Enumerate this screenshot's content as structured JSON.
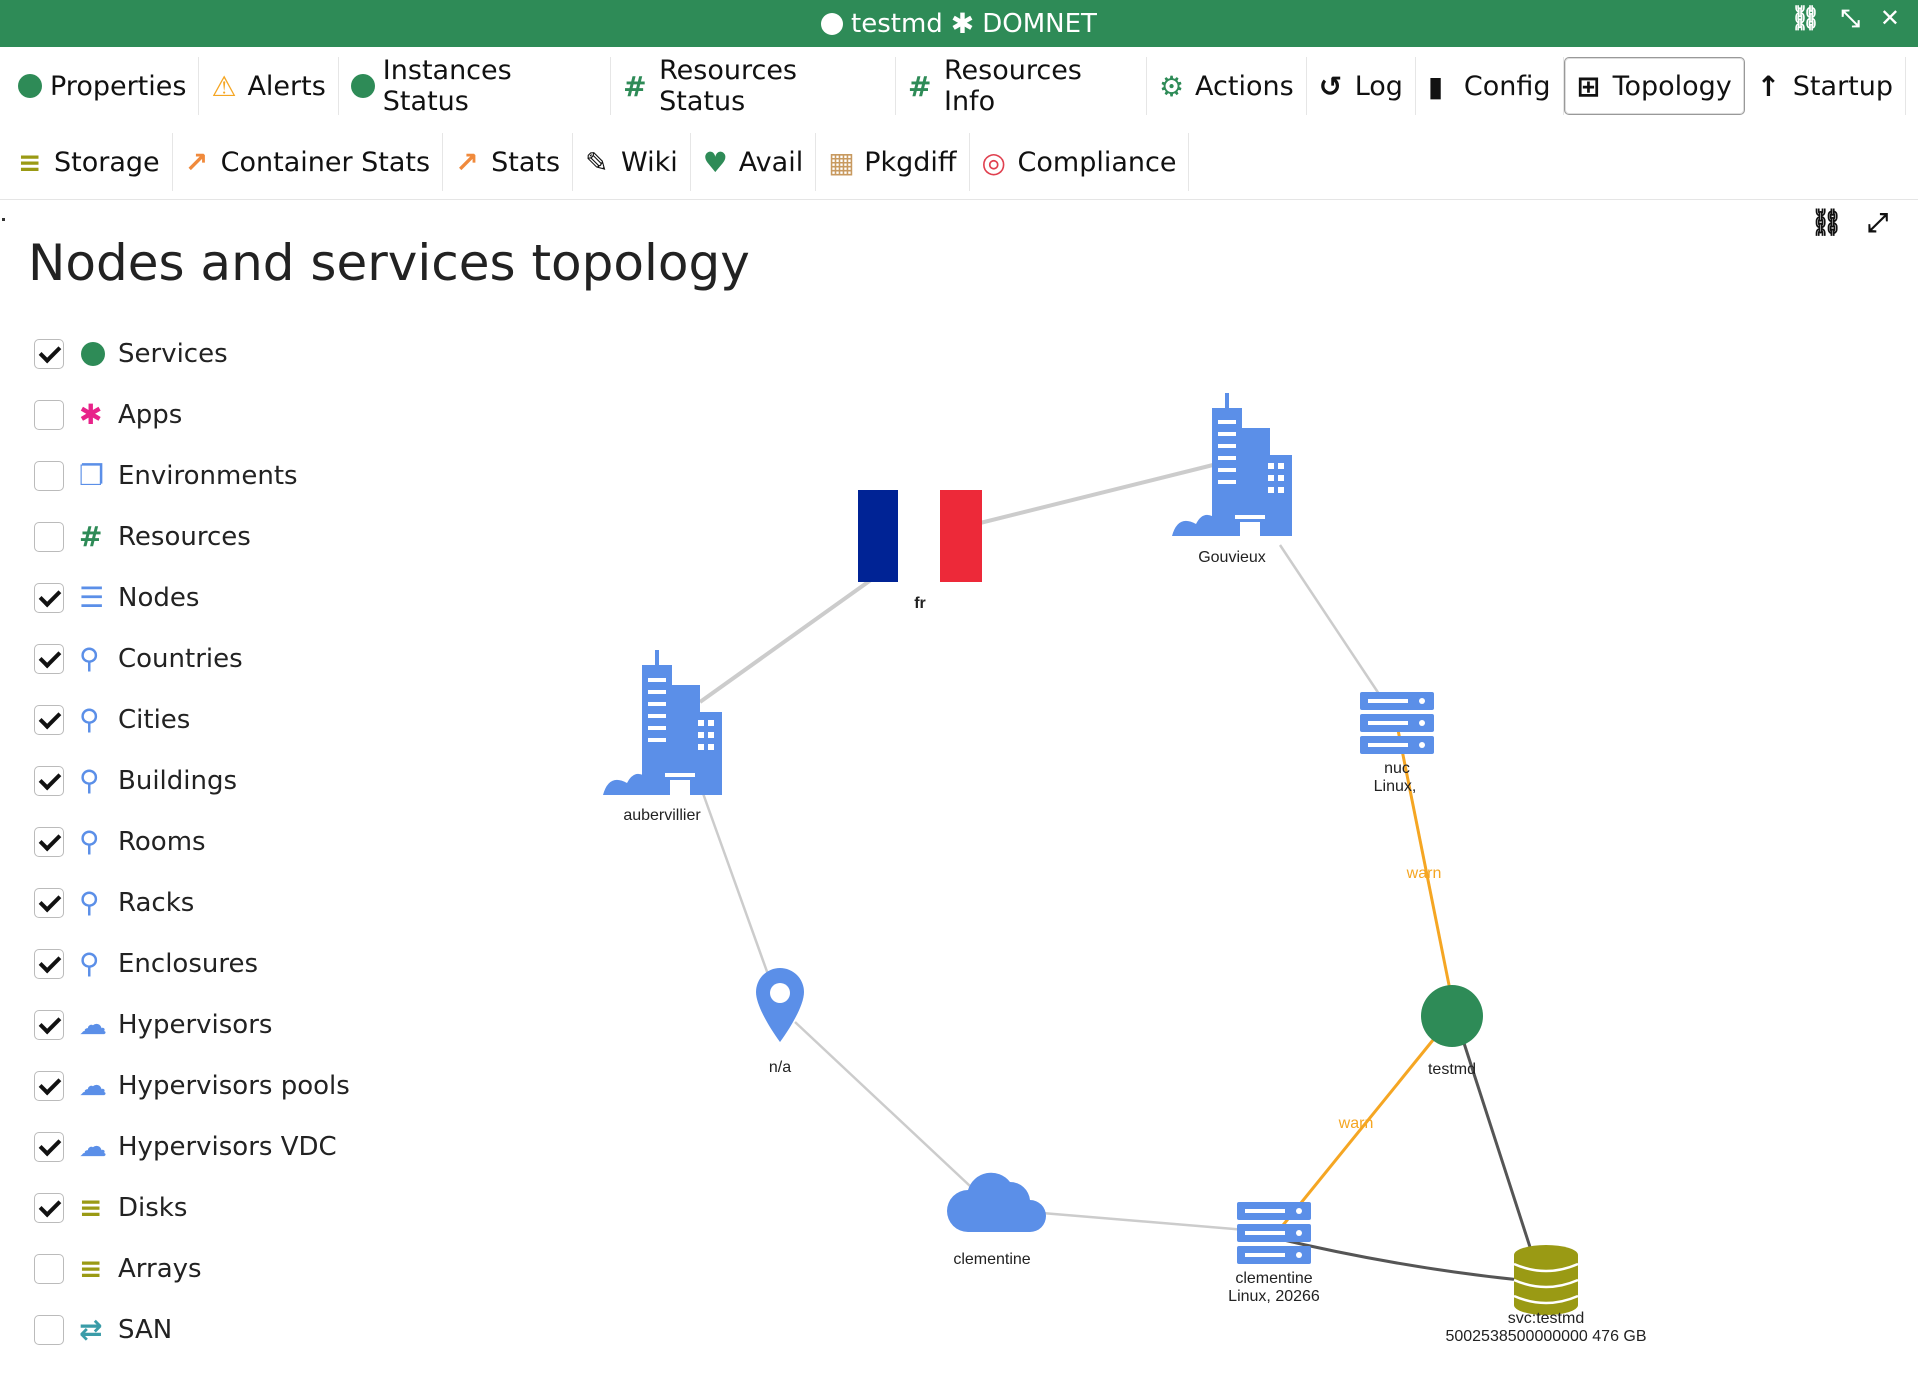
{
  "window": {
    "title_left": "testmd",
    "title_right": "DOMNET"
  },
  "title_tools": [
    "link-icon",
    "compress-icon",
    "close-icon"
  ],
  "tabs_row1": [
    {
      "label": "Properties",
      "icon": "circle-green-icon"
    },
    {
      "label": "Alerts",
      "icon": "warning-icon"
    },
    {
      "label": "Instances Status",
      "icon": "circle-green-icon"
    },
    {
      "label": "Resources Status",
      "icon": "hash-icon"
    },
    {
      "label": "Resources Info",
      "icon": "hash-icon"
    },
    {
      "label": "Actions",
      "icon": "gear-icon"
    },
    {
      "label": "Log",
      "icon": "history-icon"
    },
    {
      "label": "Config",
      "icon": "file-icon"
    },
    {
      "label": "Topology",
      "icon": "sitemap-icon",
      "active": true
    },
    {
      "label": "Startup",
      "icon": "arrow-up-icon"
    }
  ],
  "tabs_row2": [
    {
      "label": "Storage",
      "icon": "database-icon"
    },
    {
      "label": "Container Stats",
      "icon": "line-chart-icon"
    },
    {
      "label": "Stats",
      "icon": "line-chart-icon"
    },
    {
      "label": "Wiki",
      "icon": "pencil-icon"
    },
    {
      "label": "Avail",
      "icon": "heartbeat-icon"
    },
    {
      "label": "Pkgdiff",
      "icon": "cubes-icon"
    },
    {
      "label": "Compliance",
      "icon": "target-icon"
    }
  ],
  "page": {
    "title": "Nodes and services topology"
  },
  "filters": [
    {
      "label": "Services",
      "checked": true,
      "icon": "circle-green-icon"
    },
    {
      "label": "Apps",
      "checked": false,
      "icon": "asterisk-icon"
    },
    {
      "label": "Environments",
      "checked": false,
      "icon": "copy-icon"
    },
    {
      "label": "Resources",
      "checked": false,
      "icon": "hash-icon"
    },
    {
      "label": "Nodes",
      "checked": true,
      "icon": "server-icon"
    },
    {
      "label": "Countries",
      "checked": true,
      "icon": "map-pin-icon"
    },
    {
      "label": "Cities",
      "checked": true,
      "icon": "map-pin-icon"
    },
    {
      "label": "Buildings",
      "checked": true,
      "icon": "map-pin-icon"
    },
    {
      "label": "Rooms",
      "checked": true,
      "icon": "map-pin-icon"
    },
    {
      "label": "Racks",
      "checked": true,
      "icon": "map-pin-icon"
    },
    {
      "label": "Enclosures",
      "checked": true,
      "icon": "map-pin-icon"
    },
    {
      "label": "Hypervisors",
      "checked": true,
      "icon": "cloud-icon"
    },
    {
      "label": "Hypervisors pools",
      "checked": true,
      "icon": "cloud-icon"
    },
    {
      "label": "Hypervisors VDC",
      "checked": true,
      "icon": "cloud-icon"
    },
    {
      "label": "Disks",
      "checked": true,
      "icon": "database-icon"
    },
    {
      "label": "Arrays",
      "checked": false,
      "icon": "database-icon"
    },
    {
      "label": "SAN",
      "checked": false,
      "icon": "exchange-icon"
    }
  ],
  "graph": {
    "nodes": {
      "fr": {
        "label": "fr",
        "kind": "flag"
      },
      "gouvieux": {
        "label": "Gouvieux",
        "kind": "city"
      },
      "aubervillier": {
        "label": "aubervillier",
        "kind": "city"
      },
      "nuc": {
        "label1": "nuc",
        "label2": "Linux,",
        "kind": "server"
      },
      "na": {
        "label": "n/a",
        "kind": "pin"
      },
      "testmd": {
        "label": "testmd",
        "kind": "service"
      },
      "clementine_hv": {
        "label": "clementine",
        "kind": "cloud"
      },
      "clementine_node": {
        "label1": "clementine",
        "label2": "Linux, 20266",
        "kind": "server"
      },
      "disk": {
        "label1": "svc:testmd",
        "label2": "5002538500000000 476 GB",
        "kind": "disk"
      }
    },
    "edge_labels": {
      "warn1": "warn",
      "warn2": "warn"
    },
    "colors": {
      "node_blue": "#5b8fe8",
      "service_green": "#2e8b57",
      "disk_olive": "#9a9a14",
      "edge_grey": "#cccccc",
      "edge_warn": "#f5a623",
      "edge_dark": "#555555",
      "flag_blue": "#002395",
      "flag_red": "#ed2939"
    }
  }
}
